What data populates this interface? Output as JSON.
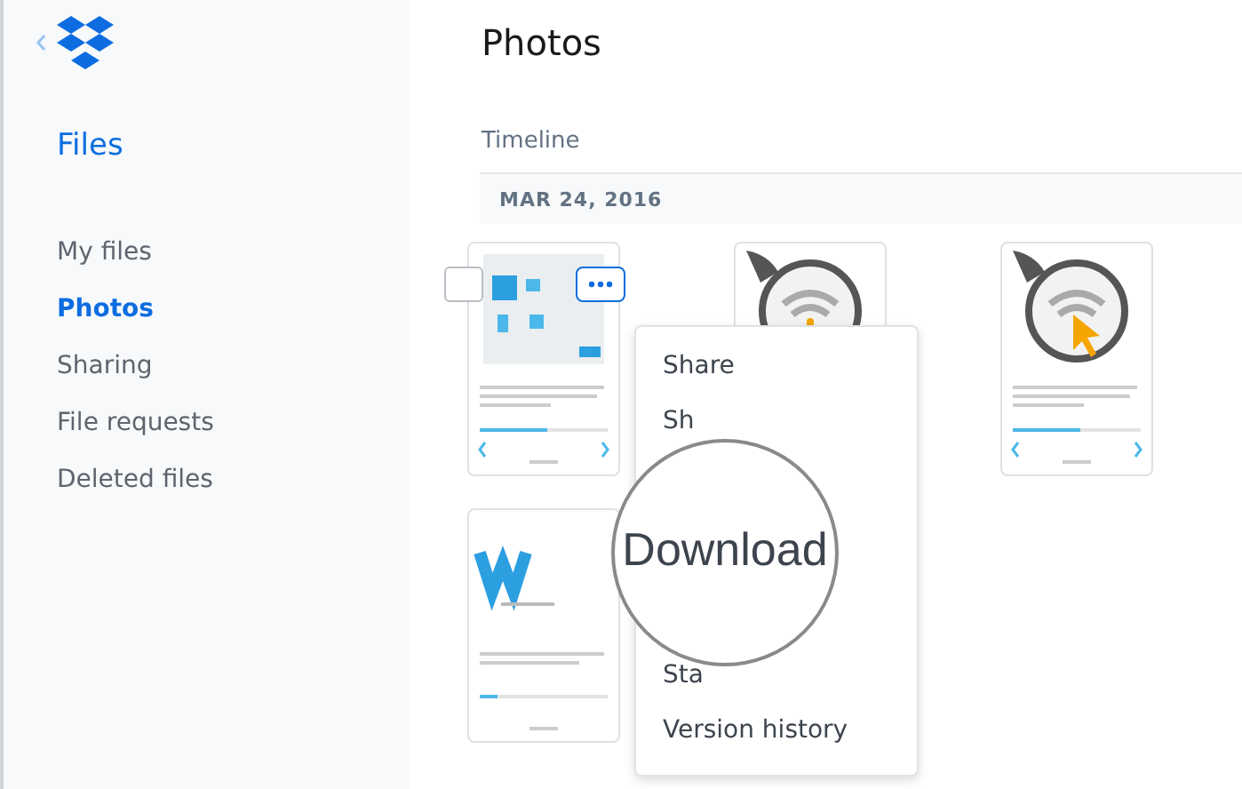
{
  "sidebar": {
    "title": "Files",
    "items": [
      {
        "label": "My files",
        "selected": false
      },
      {
        "label": "Photos",
        "selected": true
      },
      {
        "label": "Sharing",
        "selected": false
      },
      {
        "label": "File requests",
        "selected": false
      },
      {
        "label": "Deleted files",
        "selected": false
      }
    ]
  },
  "page": {
    "title": "Photos",
    "section": "Timeline"
  },
  "timeline": {
    "date": "MAR 24, 2016",
    "photos": [
      {
        "kind": "app-menu",
        "checkbox": {
          "checked": false
        }
      },
      {
        "kind": "wifi-alert"
      },
      {
        "kind": "wifi-cursor"
      },
      {
        "kind": "logo"
      }
    ]
  },
  "context_menu": {
    "items": [
      {
        "label": "Share",
        "kind": "plain"
      },
      {
        "label": "Sh",
        "kind": "plain"
      },
      {
        "label": "Download",
        "kind": "magnified"
      },
      {
        "label": "Sta",
        "kind": "plain"
      },
      {
        "label": "Version history",
        "kind": "plain"
      }
    ]
  }
}
